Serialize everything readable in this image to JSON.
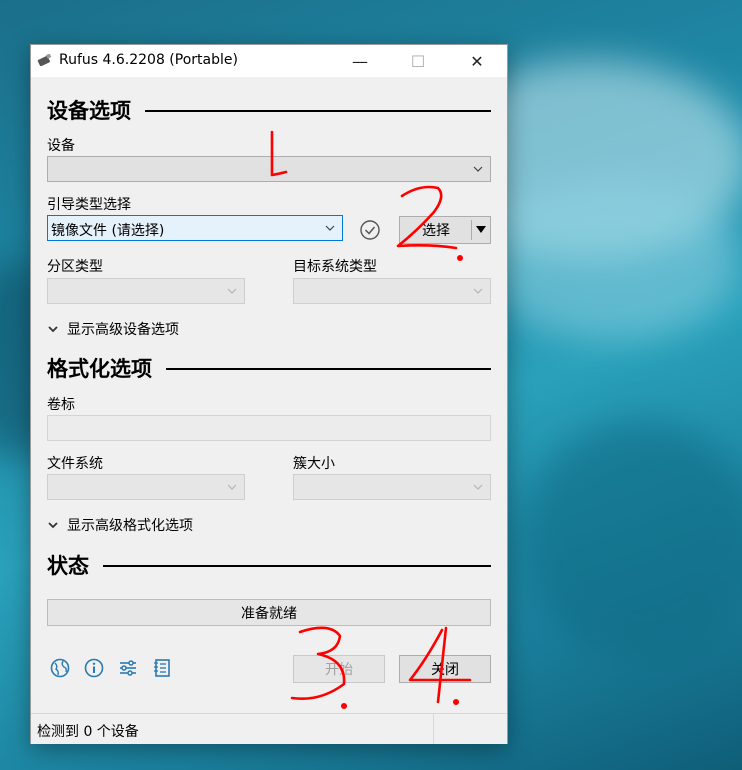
{
  "window": {
    "title": "Rufus 4.6.2208 (Portable)",
    "controls": {
      "minimize": "—",
      "maximize": "☐",
      "close": "✕"
    }
  },
  "device_section": {
    "heading": "设备选项",
    "device_label": "设备",
    "device_value": "",
    "boot_label": "引导类型选择",
    "boot_value": "镜像文件 (请选择)",
    "select_button": "选择",
    "partition_label": "分区类型",
    "target_label": "目标系统类型",
    "advanced_toggle": "显示高级设备选项"
  },
  "format_section": {
    "heading": "格式化选项",
    "volume_label": "卷标",
    "volume_value": "",
    "fs_label": "文件系统",
    "cluster_label": "簇大小",
    "advanced_toggle": "显示高级格式化选项"
  },
  "status_section": {
    "heading": "状态",
    "status_text": "准备就绪"
  },
  "buttons": {
    "start": "开始",
    "close": "关闭"
  },
  "statusbar": {
    "text": "检测到 0 个设备"
  },
  "annotations": [
    "1.",
    "2.",
    "3.",
    "4."
  ],
  "colors": {
    "accent": "#0078d7",
    "icon_blue": "#2a7ab0",
    "annotation_red": "#ff0000"
  }
}
